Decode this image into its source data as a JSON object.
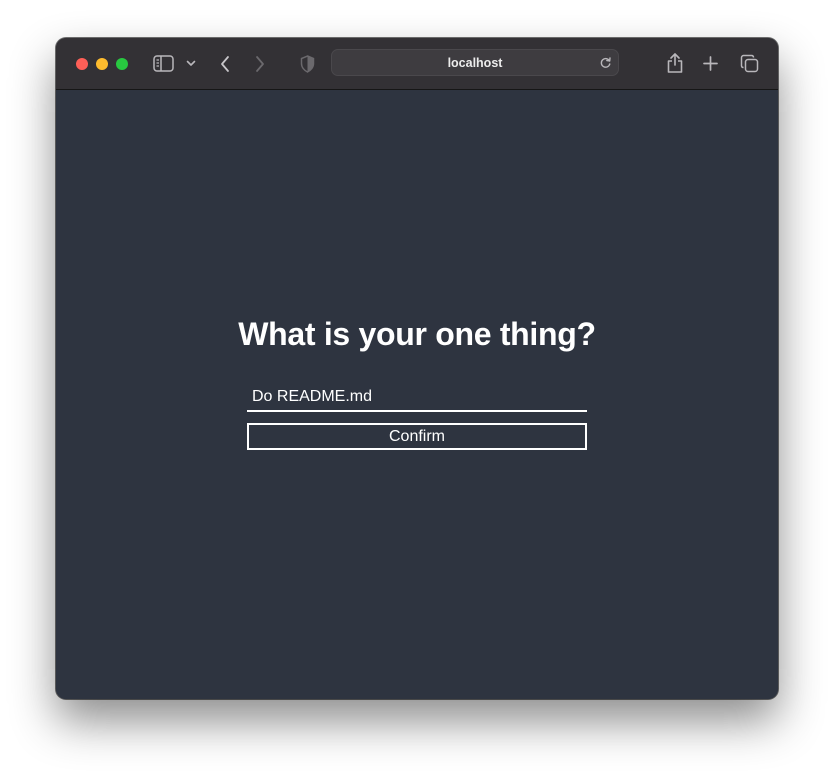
{
  "browser": {
    "address": "localhost",
    "icons": {
      "sidebar": "sidebar-icon",
      "sidebar_menu": "chevron-down-icon",
      "back": "chevron-left-icon",
      "forward": "chevron-right-icon",
      "privacy": "shield-icon",
      "reload": "reload-icon",
      "share": "share-icon",
      "new_tab": "plus-icon",
      "tabs": "tabs-overview-icon"
    }
  },
  "page": {
    "heading": "What is your one thing?",
    "input_value": "Do README.md",
    "confirm_label": "Confirm",
    "colors": {
      "background": "#2e3440",
      "foreground": "#ffffff"
    }
  }
}
